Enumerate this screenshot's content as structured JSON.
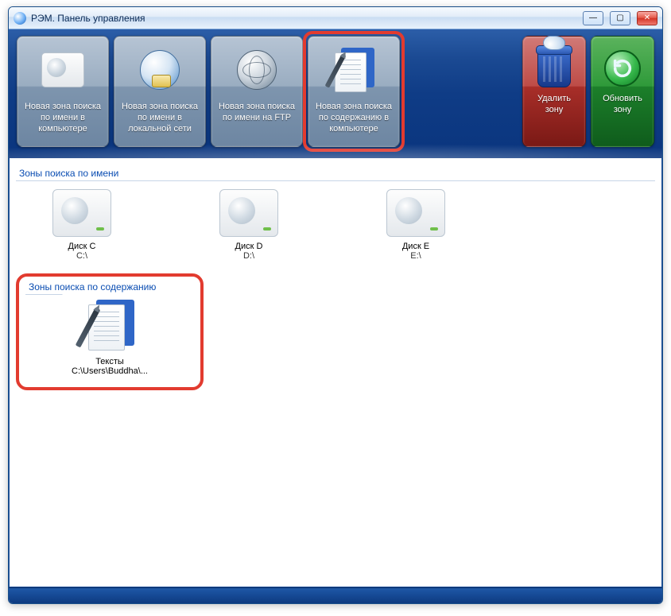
{
  "window": {
    "title": "РЭМ. Панель управления"
  },
  "toolbar": {
    "btn1": "Новая зона поиска по имени в компьютере",
    "btn2": "Новая зона поиска по имени в локальной сети",
    "btn3": "Новая зона поиска по имени на FTP",
    "btn4": "Новая зона поиска по содержанию в компьютере",
    "btn5": "Удалить зону",
    "btn6": "Обновить зону"
  },
  "sections": {
    "byName": {
      "title": "Зоны поиска по имени"
    },
    "byContent": {
      "title": "Зоны поиска по содержанию"
    }
  },
  "zonesByName": [
    {
      "name": "Диск C",
      "path": "C:\\"
    },
    {
      "name": "Диск D",
      "path": "D:\\"
    },
    {
      "name": "Диск E",
      "path": "E:\\"
    }
  ],
  "zonesByContent": [
    {
      "name": "Тексты",
      "path": "C:\\Users\\Buddha\\..."
    }
  ]
}
